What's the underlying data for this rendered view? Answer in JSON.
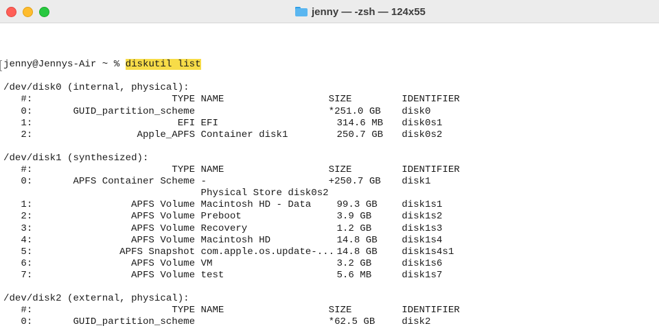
{
  "window": {
    "title": "jenny — -zsh — 124x55",
    "colors": {
      "close": "#ff5f57",
      "minimize": "#febc2e",
      "zoom": "#28c840",
      "highlight": "#f7dc48"
    }
  },
  "terminal": {
    "prompt": "jenny@Jennys-Air ~ % ",
    "command": "diskutil list",
    "header": {
      "num": "#:",
      "type": "TYPE",
      "name": "NAME",
      "size": "SIZE",
      "id": "IDENTIFIER"
    },
    "disks": [
      {
        "title": "/dev/disk0 (internal, physical):",
        "rows": [
          {
            "num": "0:",
            "type": "GUID_partition_scheme",
            "name": "",
            "size": "*251.0 GB",
            "id": "disk0"
          },
          {
            "num": "1:",
            "type": "EFI",
            "name": "EFI",
            "size": "314.6 MB",
            "id": "disk0s1"
          },
          {
            "num": "2:",
            "type": "Apple_APFS",
            "name": "Container disk1",
            "size": "250.7 GB",
            "id": "disk0s2"
          }
        ]
      },
      {
        "title": "/dev/disk1 (synthesized):",
        "rows": [
          {
            "num": "0:",
            "type": "APFS Container Scheme",
            "name": "-",
            "size": "+250.7 GB",
            "id": "disk1"
          },
          {
            "num": "",
            "type": "",
            "name": "Physical Store disk0s2",
            "size": "",
            "id": ""
          },
          {
            "num": "1:",
            "type": "APFS Volume",
            "name": "Macintosh HD - Data",
            "size": "99.3 GB",
            "id": "disk1s1"
          },
          {
            "num": "2:",
            "type": "APFS Volume",
            "name": "Preboot",
            "size": "3.9 GB",
            "id": "disk1s2"
          },
          {
            "num": "3:",
            "type": "APFS Volume",
            "name": "Recovery",
            "size": "1.2 GB",
            "id": "disk1s3"
          },
          {
            "num": "4:",
            "type": "APFS Volume",
            "name": "Macintosh HD",
            "size": "14.8 GB",
            "id": "disk1s4"
          },
          {
            "num": "5:",
            "type": "APFS Snapshot",
            "name": "com.apple.os.update-...",
            "size": "14.8 GB",
            "id": "disk1s4s1"
          },
          {
            "num": "6:",
            "type": "APFS Volume",
            "name": "VM",
            "size": "3.2 GB",
            "id": "disk1s6"
          },
          {
            "num": "7:",
            "type": "APFS Volume",
            "name": "test",
            "size": "5.6 MB",
            "id": "disk1s7"
          }
        ]
      },
      {
        "title": "/dev/disk2 (external, physical):",
        "rows": [
          {
            "num": "0:",
            "type": "GUID_partition_scheme",
            "name": "",
            "size": "*62.5 GB",
            "id": "disk2"
          }
        ]
      }
    ]
  }
}
